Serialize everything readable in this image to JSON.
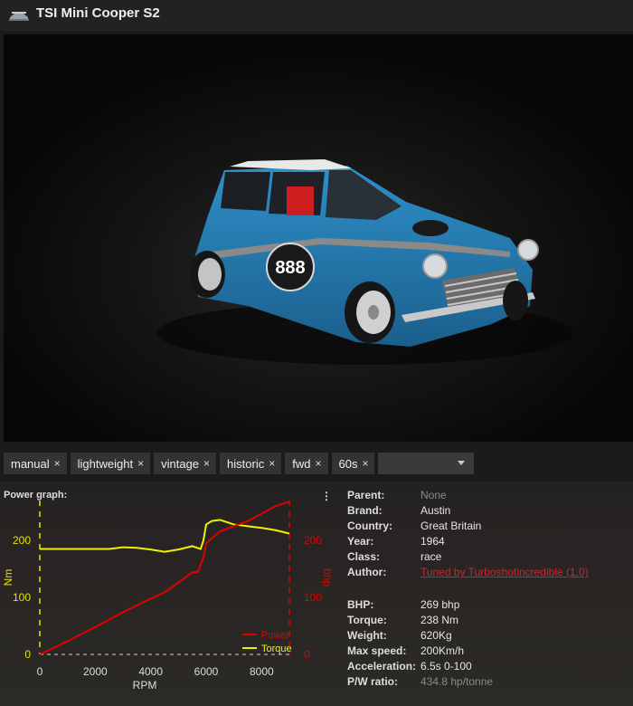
{
  "window": {
    "title": "TSI Mini Cooper S2"
  },
  "preview": {
    "car_number": "888"
  },
  "tags": [
    "manual",
    "lightweight",
    "vintage",
    "historic",
    "fwd",
    "60s"
  ],
  "tag_remove_glyph": "×",
  "graph": {
    "title": "Power graph:",
    "menu_glyph": "⋮"
  },
  "chart_data": {
    "type": "line",
    "xlabel": "RPM",
    "ylabel_left": "Nm",
    "ylabel_right": "bhp",
    "x_ticks": [
      0,
      2000,
      4000,
      6000,
      8000
    ],
    "y_left_ticks": [
      0,
      100,
      200
    ],
    "y_right_ticks": [
      0,
      100,
      200
    ],
    "xlim": [
      0,
      9000
    ],
    "ylim_left": [
      0,
      270
    ],
    "ylim_right": [
      0,
      270
    ],
    "legend": "bottom-right",
    "series": [
      {
        "name": "Power",
        "color": "#e00000",
        "x": [
          0,
          1000,
          2000,
          3000,
          4000,
          4500,
          5000,
          5500,
          5700,
          5900,
          6000,
          6500,
          7000,
          7500,
          8000,
          8500,
          9000
        ],
        "y": [
          0,
          23,
          48,
          74,
          98,
          109,
          126,
          144,
          145,
          170,
          195,
          216,
          225,
          234,
          247,
          260,
          268
        ]
      },
      {
        "name": "Torque",
        "color": "#f0f000",
        "x": [
          0,
          1000,
          2000,
          2500,
          3000,
          3500,
          4000,
          4500,
          5000,
          5500,
          5800,
          5900,
          6000,
          6200,
          6500,
          7000,
          7500,
          8000,
          8500,
          9000
        ],
        "y": [
          185,
          185,
          185,
          185,
          188,
          187,
          184,
          180,
          184,
          190,
          185,
          200,
          228,
          234,
          236,
          228,
          225,
          222,
          218,
          212
        ]
      }
    ]
  },
  "specs": {
    "parent": {
      "label": "Parent:",
      "value": "None"
    },
    "brand": {
      "label": "Brand:",
      "value": "Austin"
    },
    "country": {
      "label": "Country:",
      "value": "Great Britain"
    },
    "year": {
      "label": "Year:",
      "value": "1964"
    },
    "class": {
      "label": "Class:",
      "value": "race"
    },
    "author": {
      "label": "Author:",
      "value": "Tuned by Turboshotincredible (1.0)"
    },
    "bhp": {
      "label": "BHP:",
      "value": "269 bhp"
    },
    "torque": {
      "label": "Torque:",
      "value": "238 Nm"
    },
    "weight": {
      "label": "Weight:",
      "value": "620Kg"
    },
    "max_speed": {
      "label": "Max speed:",
      "value": "200Km/h"
    },
    "acceleration": {
      "label": "Acceleration:",
      "value": "6.5s 0-100"
    },
    "pw_ratio": {
      "label": "P/W ratio:",
      "value": "434.8 hp/tonne"
    }
  }
}
